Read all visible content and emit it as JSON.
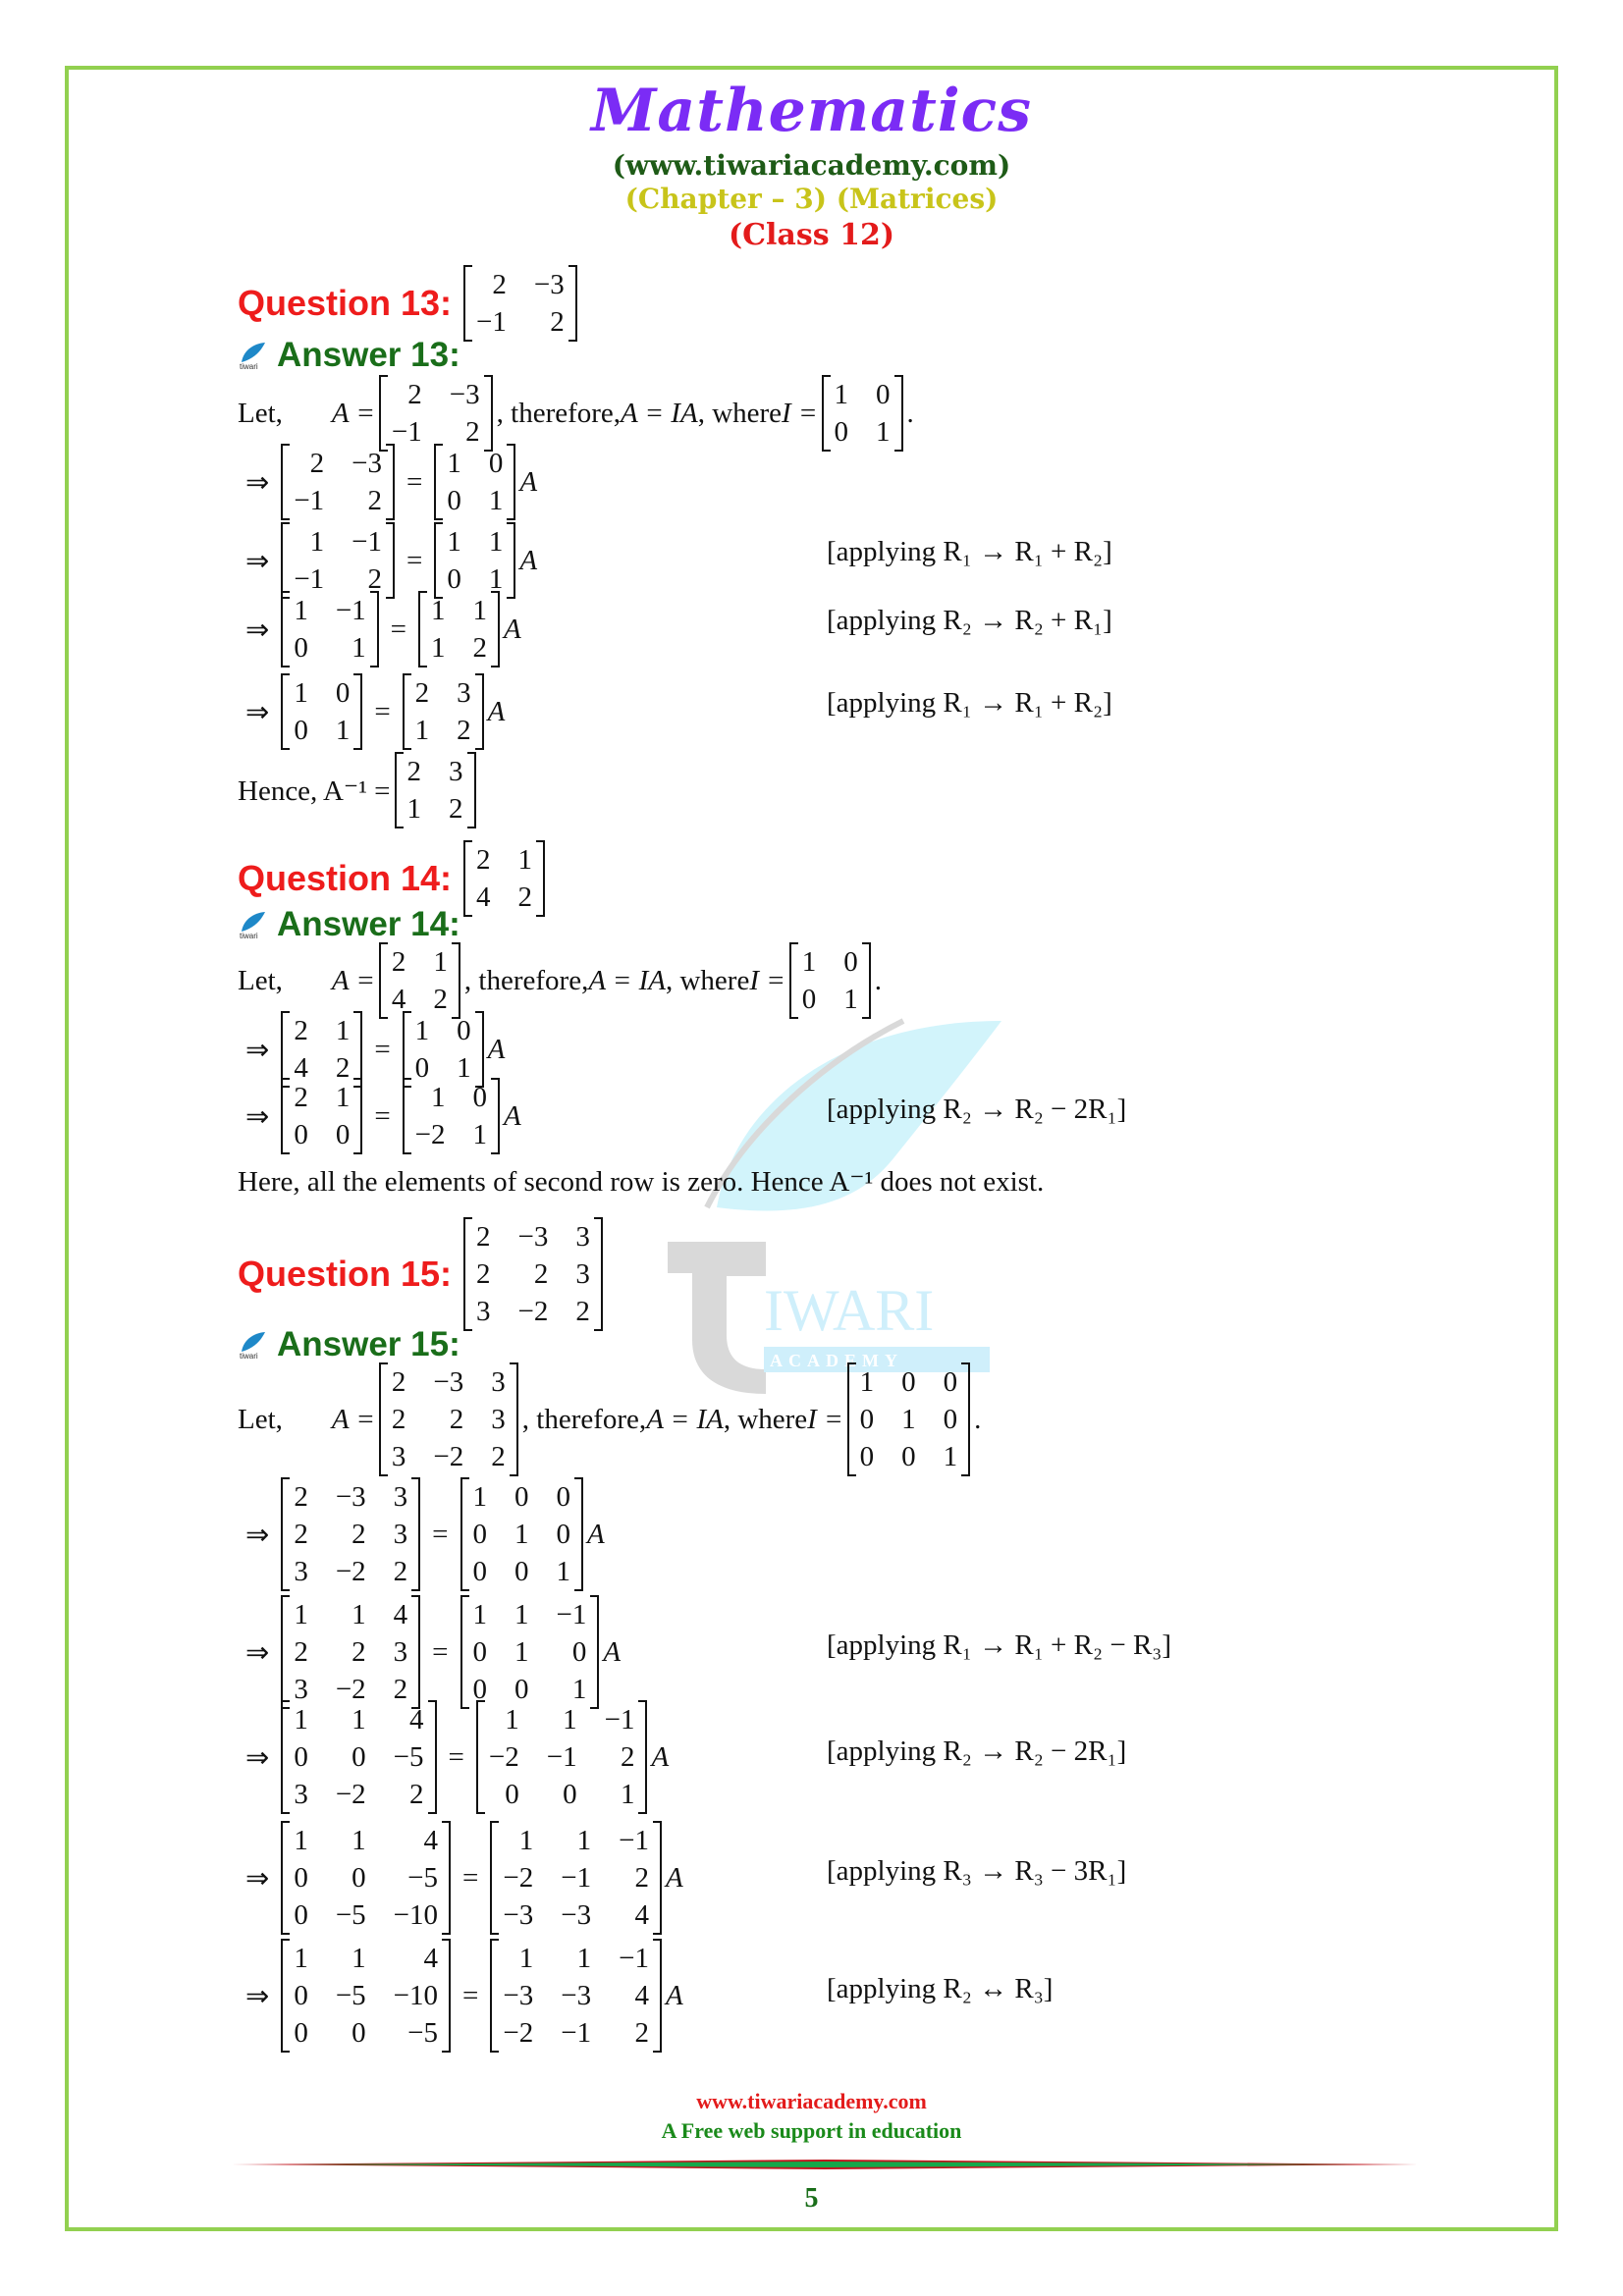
{
  "header": {
    "title": "Mathematics",
    "website": "(www.tiwariacademy.com)",
    "chapter": "(Chapter – 3) (Matrices)",
    "class": "(Class 12)"
  },
  "watermark": {
    "big": "IWARI",
    "small": "A C A D E M Y",
    "icon": "tiwari-leaf-logo"
  },
  "questions": [
    {
      "q_label": "Question 13:",
      "a_label": "Answer 13:",
      "matrix": [
        [
          "2",
          "−3"
        ],
        [
          "−1",
          "2"
        ]
      ],
      "let_text": {
        "let": "Let,",
        "A_eq": "A =",
        "therefore": ", therefore, ",
        "A_IA": "A = IA",
        "where": ", where ",
        "I_eq": "I =",
        "period": "."
      },
      "identity": [
        [
          "1",
          "0"
        ],
        [
          "0",
          "1"
        ]
      ],
      "steps": [
        {
          "lhs": [
            [
              "2",
              "−3"
            ],
            [
              "−1",
              "2"
            ]
          ],
          "rhs": [
            [
              "1",
              "0"
            ],
            [
              "0",
              "1"
            ]
          ],
          "note": ""
        },
        {
          "lhs": [
            [
              "1",
              "−1"
            ],
            [
              "−1",
              "2"
            ]
          ],
          "rhs": [
            [
              "1",
              "1"
            ],
            [
              "0",
              "1"
            ]
          ],
          "note": "[applying R₁ → R₁ + R₂]"
        },
        {
          "lhs": [
            [
              "1",
              "−1"
            ],
            [
              "0",
              "1"
            ]
          ],
          "rhs": [
            [
              "1",
              "1"
            ],
            [
              "1",
              "2"
            ]
          ],
          "note": "[applying R₂ → R₂ + R₁]"
        },
        {
          "lhs": [
            [
              "1",
              "0"
            ],
            [
              "0",
              "1"
            ]
          ],
          "rhs": [
            [
              "2",
              "3"
            ],
            [
              "1",
              "2"
            ]
          ],
          "note": "[applying R₁ → R₁ + R₂]"
        }
      ],
      "conclusion": {
        "text": "Hence, A⁻¹ =",
        "matrix": [
          [
            "2",
            "3"
          ],
          [
            "1",
            "2"
          ]
        ]
      }
    },
    {
      "q_label": "Question 14:",
      "a_label": "Answer 14:",
      "matrix": [
        [
          "2",
          "1"
        ],
        [
          "4",
          "2"
        ]
      ],
      "identity": [
        [
          "1",
          "0"
        ],
        [
          "0",
          "1"
        ]
      ],
      "steps": [
        {
          "lhs": [
            [
              "2",
              "1"
            ],
            [
              "4",
              "2"
            ]
          ],
          "rhs": [
            [
              "1",
              "0"
            ],
            [
              "0",
              "1"
            ]
          ],
          "note": ""
        },
        {
          "lhs": [
            [
              "2",
              "1"
            ],
            [
              "0",
              "0"
            ]
          ],
          "rhs": [
            [
              "1",
              "0"
            ],
            [
              "−2",
              "1"
            ]
          ],
          "note": "[applying R₂ → R₂ − 2R₁]"
        }
      ],
      "conclusion": {
        "text": "Here, all the elements of second row is zero. Hence A⁻¹ does not exist."
      }
    },
    {
      "q_label": "Question 15:",
      "a_label": "Answer 15:",
      "matrix": [
        [
          "2",
          "−3",
          "3"
        ],
        [
          "2",
          "2",
          "3"
        ],
        [
          "3",
          "−2",
          "2"
        ]
      ],
      "identity": [
        [
          "1",
          "0",
          "0"
        ],
        [
          "0",
          "1",
          "0"
        ],
        [
          "0",
          "0",
          "1"
        ]
      ],
      "steps": [
        {
          "lhs": [
            [
              "2",
              "−3",
              "3"
            ],
            [
              "2",
              "2",
              "3"
            ],
            [
              "3",
              "−2",
              "2"
            ]
          ],
          "rhs": [
            [
              "1",
              "0",
              "0"
            ],
            [
              "0",
              "1",
              "0"
            ],
            [
              "0",
              "0",
              "1"
            ]
          ],
          "note": ""
        },
        {
          "lhs": [
            [
              "1",
              "1",
              "4"
            ],
            [
              "2",
              "2",
              "3"
            ],
            [
              "3",
              "−2",
              "2"
            ]
          ],
          "rhs": [
            [
              "1",
              "1",
              "−1"
            ],
            [
              "0",
              "1",
              "0"
            ],
            [
              "0",
              "0",
              "1"
            ]
          ],
          "note": "[applying R₁ → R₁ + R₂ − R₃]"
        },
        {
          "lhs": [
            [
              "1",
              "1",
              "4"
            ],
            [
              "0",
              "0",
              "−5"
            ],
            [
              "3",
              "−2",
              "2"
            ]
          ],
          "rhs": [
            [
              "1",
              "1",
              "−1"
            ],
            [
              "−2",
              "−1",
              "2"
            ],
            [
              "0",
              "0",
              "1"
            ]
          ],
          "note": "[applying R₂ → R₂ − 2R₁]"
        },
        {
          "lhs": [
            [
              "1",
              "1",
              "4"
            ],
            [
              "0",
              "0",
              "−5"
            ],
            [
              "0",
              "−5",
              "−10"
            ]
          ],
          "rhs": [
            [
              "1",
              "1",
              "−1"
            ],
            [
              "−2",
              "−1",
              "2"
            ],
            [
              "−3",
              "−3",
              "4"
            ]
          ],
          "note": "[applying R₃ → R₃ − 3R₁]"
        },
        {
          "lhs": [
            [
              "1",
              "1",
              "4"
            ],
            [
              "0",
              "−5",
              "−10"
            ],
            [
              "0",
              "0",
              "−5"
            ]
          ],
          "rhs": [
            [
              "1",
              "1",
              "−1"
            ],
            [
              "−3",
              "−3",
              "4"
            ],
            [
              "−2",
              "−1",
              "2"
            ]
          ],
          "note": "[applying R₂ ↔ R₃]"
        }
      ]
    }
  ],
  "symbols": {
    "implies": "⇒",
    "equals": "=",
    "A": "A"
  },
  "footer": {
    "website": "www.tiwariacademy.com",
    "tagline": "A Free web support in education",
    "page_number": "5"
  },
  "colors": {
    "border": "#92d050",
    "title": "#7b2cf5",
    "question": "#ee1c1c",
    "answer": "#1a6e1a",
    "chapter": "#c8c41a"
  }
}
